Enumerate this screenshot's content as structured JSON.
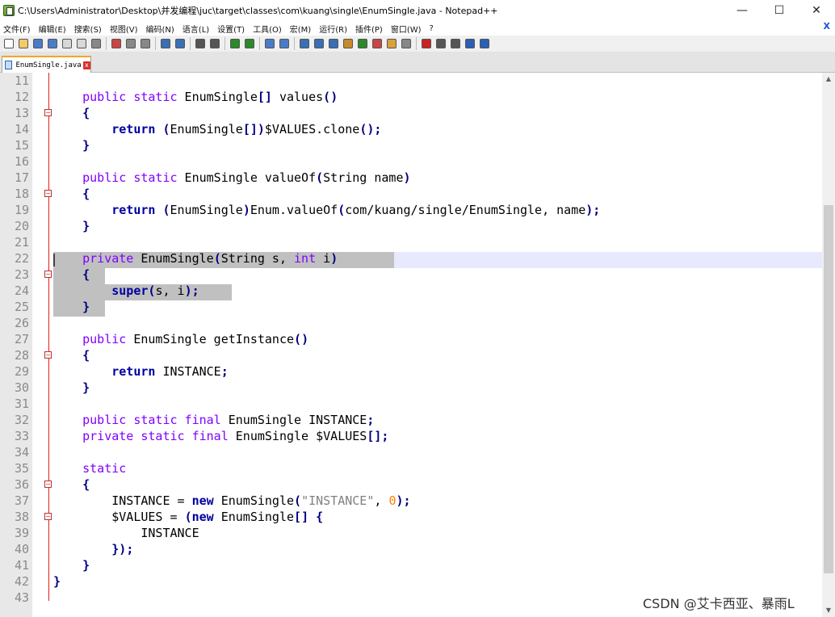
{
  "window": {
    "title": "C:\\Users\\Administrator\\Desktop\\并发编程\\juc\\target\\classes\\com\\kuang\\single\\EnumSingle.java - Notepad++",
    "minimize": "—",
    "maximize": "☐",
    "close": "✕"
  },
  "menu": {
    "items": [
      "文件(F)",
      "编辑(E)",
      "搜索(S)",
      "视图(V)",
      "编码(N)",
      "语言(L)",
      "设置(T)",
      "工具(O)",
      "宏(M)",
      "运行(R)",
      "插件(P)",
      "窗口(W)",
      "?"
    ],
    "close_doc": "X"
  },
  "tab": {
    "label": "EnumSingle.java",
    "close": "x"
  },
  "editor": {
    "lines": [
      {
        "n": "11",
        "code": ""
      },
      {
        "n": "12",
        "code": "    public static EnumSingle[] values()"
      },
      {
        "n": "13",
        "code": "    {"
      },
      {
        "n": "14",
        "code": "        return (EnumSingle[])$VALUES.clone();"
      },
      {
        "n": "15",
        "code": "    }"
      },
      {
        "n": "16",
        "code": ""
      },
      {
        "n": "17",
        "code": "    public static EnumSingle valueOf(String name)"
      },
      {
        "n": "18",
        "code": "    {"
      },
      {
        "n": "19",
        "code": "        return (EnumSingle)Enum.valueOf(com/kuang/single/EnumSingle, name);"
      },
      {
        "n": "20",
        "code": "    }"
      },
      {
        "n": "21",
        "code": ""
      },
      {
        "n": "22",
        "code": "    private EnumSingle(String s, int i)"
      },
      {
        "n": "23",
        "code": "    {"
      },
      {
        "n": "24",
        "code": "        super(s, i);"
      },
      {
        "n": "25",
        "code": "    }"
      },
      {
        "n": "26",
        "code": ""
      },
      {
        "n": "27",
        "code": "    public EnumSingle getInstance()"
      },
      {
        "n": "28",
        "code": "    {"
      },
      {
        "n": "29",
        "code": "        return INSTANCE;"
      },
      {
        "n": "30",
        "code": "    }"
      },
      {
        "n": "31",
        "code": ""
      },
      {
        "n": "32",
        "code": "    public static final EnumSingle INSTANCE;"
      },
      {
        "n": "33",
        "code": "    private static final EnumSingle $VALUES[];"
      },
      {
        "n": "34",
        "code": ""
      },
      {
        "n": "35",
        "code": "    static"
      },
      {
        "n": "36",
        "code": "    {"
      },
      {
        "n": "37",
        "code": "        INSTANCE = new EnumSingle(\"INSTANCE\", 0);"
      },
      {
        "n": "38",
        "code": "        $VALUES = (new EnumSingle[] {"
      },
      {
        "n": "39",
        "code": "            INSTANCE"
      },
      {
        "n": "40",
        "code": "        });"
      },
      {
        "n": "41",
        "code": "    }"
      },
      {
        "n": "42",
        "code": "}"
      },
      {
        "n": "43",
        "code": ""
      }
    ],
    "fold_lines": [
      "13",
      "18",
      "23",
      "28",
      "36",
      "38"
    ]
  },
  "watermark": "CSDN @艾卡西亚、暴雨L",
  "colors": {
    "keyword": "#8000ff",
    "keyword_bold": "#0000a0",
    "string": "#808080",
    "number": "#ff8000",
    "fold_margin": "#e02020",
    "current_line": "#e8e8ff",
    "selection": "#c0c0c0"
  },
  "icons": {
    "toolbar": [
      "new-file-icon",
      "open-file-icon",
      "save-icon",
      "save-all-icon",
      "close-icon",
      "close-all-icon",
      "print-icon",
      "cut-icon",
      "copy-icon",
      "paste-icon",
      "undo-icon",
      "redo-icon",
      "find-icon",
      "replace-icon",
      "zoom-in-icon",
      "zoom-out-icon",
      "sync-vertical-icon",
      "sync-horizontal-icon",
      "word-wrap-icon",
      "show-all-chars-icon",
      "indent-guide-icon",
      "language-icon",
      "doc-map-icon",
      "function-list-icon",
      "folder-workspace-icon",
      "monitor-icon",
      "record-macro-icon",
      "stop-record-icon",
      "play-macro-icon",
      "run-macro-multiple-icon",
      "save-macro-icon"
    ]
  }
}
